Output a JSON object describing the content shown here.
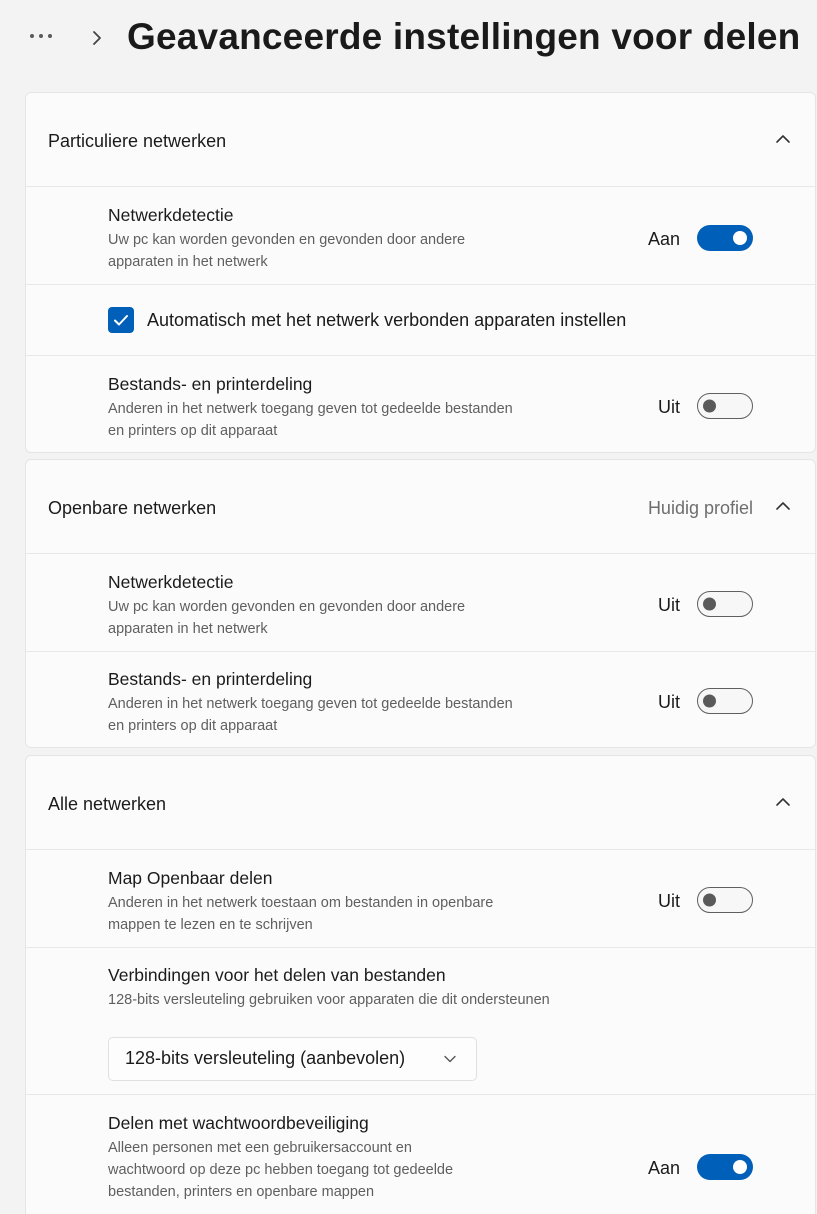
{
  "header": {
    "title": "Geavanceerde instellingen voor delen"
  },
  "sections": [
    {
      "title": "Particuliere netwerken",
      "meta": "",
      "rows": [
        {
          "title": "Netwerkdetectie",
          "desc": "Uw pc kan worden gevonden en gevonden door andere apparaten in het netwerk",
          "state": "Aan",
          "toggle_on": true
        },
        {
          "checkbox_label": "Automatisch met het netwerk verbonden apparaten instellen",
          "checked": true
        },
        {
          "title": "Bestands- en printerdeling",
          "desc": "Anderen in het netwerk toegang geven tot gedeelde bestanden en printers op dit apparaat",
          "state": "Uit",
          "toggle_on": false
        }
      ]
    },
    {
      "title": "Openbare netwerken",
      "meta": "Huidig profiel",
      "rows": [
        {
          "title": "Netwerkdetectie",
          "desc": "Uw pc kan worden gevonden en gevonden door andere apparaten in het netwerk",
          "state": "Uit",
          "toggle_on": false
        },
        {
          "title": "Bestands- en printerdeling",
          "desc": "Anderen in het netwerk toegang geven tot gedeelde bestanden en printers op dit apparaat",
          "state": "Uit",
          "toggle_on": false
        }
      ]
    },
    {
      "title": "Alle netwerken",
      "meta": "",
      "rows": [
        {
          "title": "Map Openbaar delen",
          "desc": "Anderen in het netwerk toestaan om bestanden in openbare mappen te lezen en te schrijven",
          "state": "Uit",
          "toggle_on": false
        },
        {
          "title": "Verbindingen voor het delen van bestanden",
          "desc": "128-bits versleuteling gebruiken voor apparaten die dit ondersteunen",
          "dropdown_value": "128-bits versleuteling (aanbevolen)"
        },
        {
          "title": "Delen met wachtwoordbeveiliging",
          "desc": "Alleen personen met een gebruikersaccount en wachtwoord op deze pc hebben toegang tot gedeelde bestanden, printers en openbare mappen",
          "state": "Aan",
          "toggle_on": true
        }
      ]
    }
  ],
  "colors": {
    "accent": "#005fb8",
    "background": "#f3f3f3",
    "card": "#fbfbfb"
  },
  "icons": [
    "more-icon",
    "chevron-right-icon",
    "chevron-up-icon",
    "checkmark-icon",
    "chevron-down-icon"
  ]
}
